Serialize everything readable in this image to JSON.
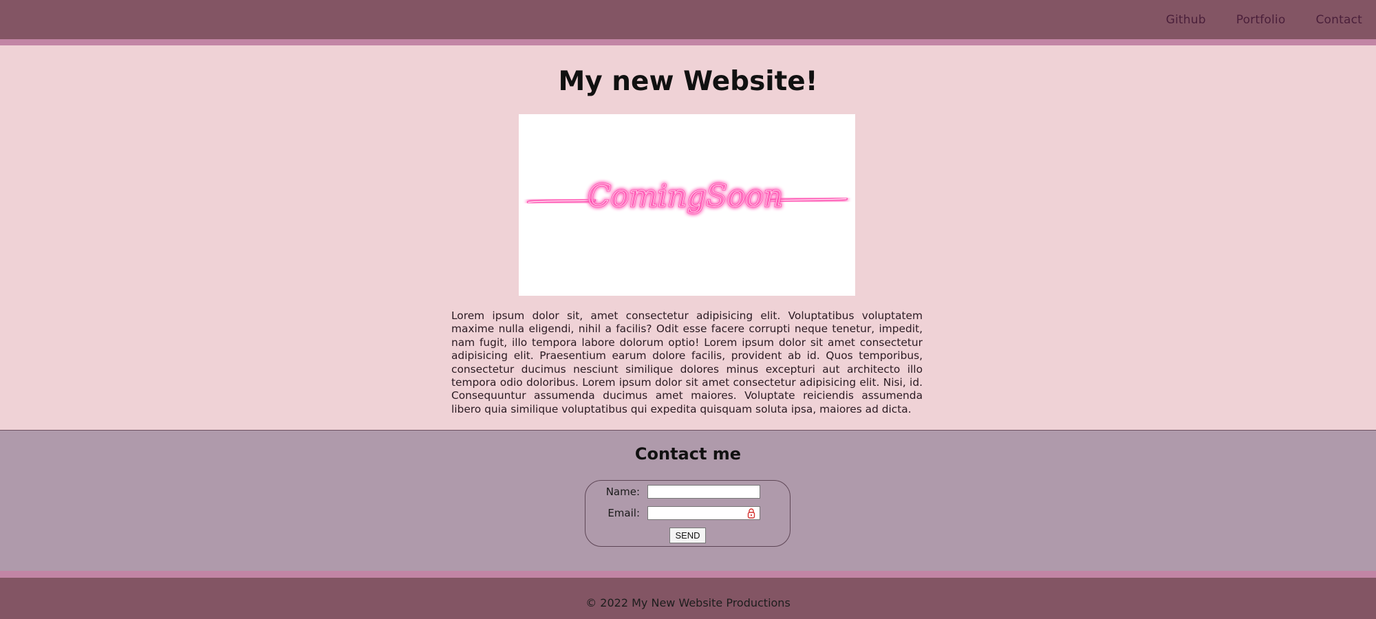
{
  "nav": {
    "items": [
      {
        "label": "Github"
      },
      {
        "label": "Portfolio"
      },
      {
        "label": "Contact"
      }
    ]
  },
  "main": {
    "title": "My new Website!",
    "hero_image_alt": "Coming Soon",
    "hero_text": "ComingSoon",
    "paragraph": "Lorem ipsum dolor sit, amet consectetur adipisicing elit. Voluptatibus voluptatem maxime nulla eligendi, nihil a facilis? Odit esse facere corrupti neque tenetur, impedit, nam fugit, illo tempora labore dolorum optio! Lorem ipsum dolor sit amet consectetur adipisicing elit. Praesentium earum dolore facilis, provident ab id. Quos temporibus, consectetur ducimus nesciunt similique dolores minus excepturi aut architecto illo tempora odio doloribus. Lorem ipsum dolor sit amet consectetur adipisicing elit. Nisi, id. Consequuntur assumenda ducimus amet maiores. Voluptate reiciendis assumenda libero quia similique voluptatibus qui expedita quisquam soluta ipsa, maiores ad dicta."
  },
  "contact": {
    "title": "Contact me",
    "name_label": "Name:",
    "name_value": "",
    "email_label": "Email:",
    "email_value": "",
    "send_label": "SEND"
  },
  "footer": {
    "text": "© 2022 My New Website Productions"
  },
  "colors": {
    "header_bg": "#835564",
    "stripe": "#c285a5",
    "main_bg": "#efd2d6",
    "contact_bg": "#af9aab",
    "neon_pink": "#ff4fb0"
  }
}
